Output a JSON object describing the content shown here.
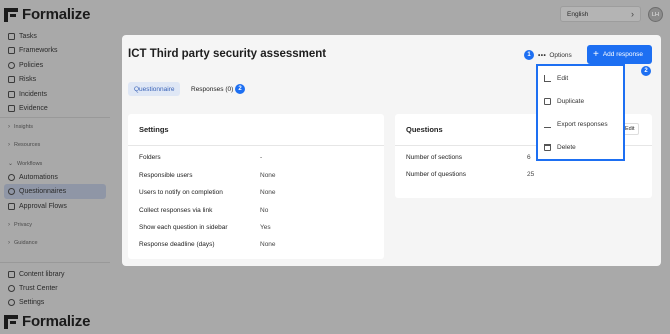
{
  "app": {
    "name": "Formalize"
  },
  "sidebar": {
    "items": [
      {
        "label": "Tasks",
        "icon": "checkbox-icon"
      },
      {
        "label": "Frameworks",
        "icon": "grid-icon"
      },
      {
        "label": "Policies",
        "icon": "shield-icon"
      },
      {
        "label": "Risks",
        "icon": "warning-icon"
      },
      {
        "label": "Incidents",
        "icon": "incident-icon"
      },
      {
        "label": "Evidence",
        "icon": "document-icon"
      }
    ],
    "groups": {
      "insights": "Insights",
      "resources": "Resources",
      "workflows": "Workflows",
      "privacy": "Privacy",
      "guidance": "Guidance"
    },
    "workflow_items": [
      {
        "label": "Automations",
        "icon": "automation-icon"
      },
      {
        "label": "Questionnaires",
        "icon": "questionnaire-icon",
        "active": true
      },
      {
        "label": "Approval Flows",
        "icon": "approval-icon"
      }
    ],
    "bottom_items": [
      {
        "label": "Content library",
        "icon": "library-icon"
      },
      {
        "label": "Trust Center",
        "icon": "globe-icon"
      },
      {
        "label": "Settings",
        "icon": "gear-icon"
      }
    ]
  },
  "topbar": {
    "language": "English",
    "avatar_initials": "LH"
  },
  "page": {
    "title": "ICT Third party security assessment",
    "options_label": "Options",
    "add_response_label": "Add response",
    "badge1": "1",
    "badge2": "2",
    "tabs": [
      {
        "label": "Questionnaire",
        "active": true
      },
      {
        "label": "Responses (0)",
        "active": false
      }
    ],
    "tab_badge": "2"
  },
  "settings_card": {
    "title": "Settings",
    "rows": [
      {
        "label": "Folders",
        "value": "-"
      },
      {
        "label": "Responsible users",
        "value": "None"
      },
      {
        "label": "Users to notify on completion",
        "value": "None"
      },
      {
        "label": "Collect responses via link",
        "value": "No"
      },
      {
        "label": "Show each question in sidebar",
        "value": "Yes"
      },
      {
        "label": "Response deadline (days)",
        "value": "None"
      }
    ]
  },
  "questions_card": {
    "title": "Questions",
    "edit_label": "Edit",
    "rows": [
      {
        "label": "Number of sections",
        "value": "6"
      },
      {
        "label": "Number of questions",
        "value": "25"
      }
    ]
  },
  "dropdown": {
    "items": [
      {
        "label": "Edit",
        "icon": "pencil-icon"
      },
      {
        "label": "Duplicate",
        "icon": "copy-icon"
      },
      {
        "label": "Export responses",
        "icon": "download-icon"
      },
      {
        "label": "Delete",
        "icon": "trash-icon"
      }
    ]
  },
  "colors": {
    "accent": "#1d6ff2",
    "overlay": "#a9a9a9",
    "panel": "#f5f5f5"
  }
}
